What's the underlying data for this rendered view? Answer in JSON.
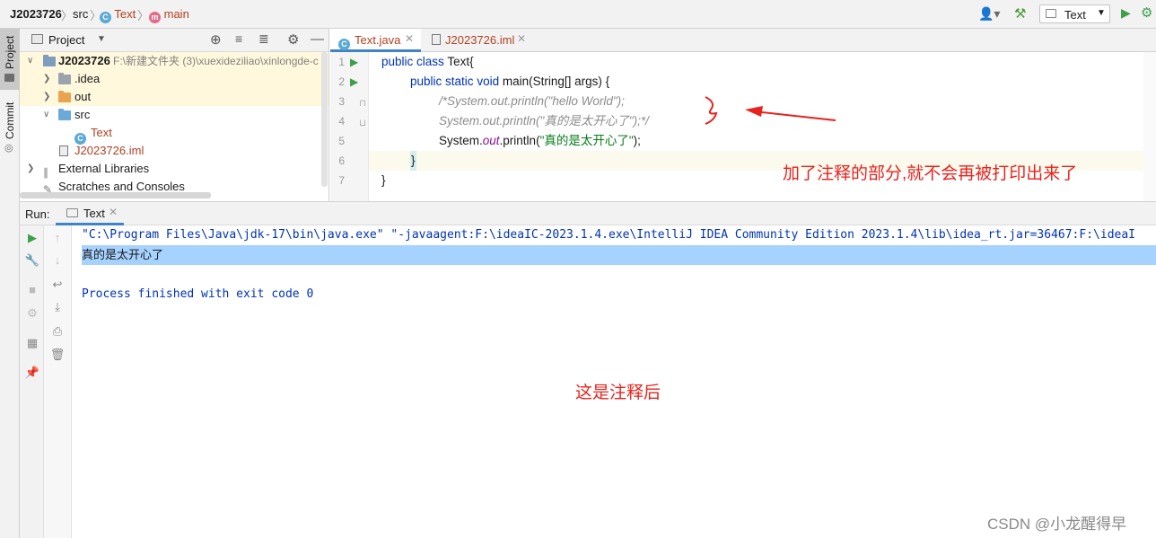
{
  "navbar": {
    "project": "J2023726",
    "src": "src",
    "class": "Text",
    "method": "main",
    "class_icon_letter": "C",
    "method_icon_letter": "m",
    "run_config": "Text"
  },
  "left_strip": {
    "project_tab": "Project",
    "commit_tab": "Commit"
  },
  "project_panel": {
    "title": "Project",
    "tree": [
      {
        "label": "J2023726",
        "path": "F:\\新建文件夹 (3)\\xuexideziliao\\xinlongde-c"
      },
      {
        "label": ".idea"
      },
      {
        "label": "out"
      },
      {
        "label": "src"
      },
      {
        "label": "Text"
      },
      {
        "label": "J2023726.iml"
      },
      {
        "label": "External Libraries"
      },
      {
        "label": "Scratches and Consoles"
      }
    ]
  },
  "editor": {
    "tabs": [
      {
        "label": "Text.java"
      },
      {
        "label": "J2023726.iml"
      }
    ],
    "line_numbers": [
      "1",
      "2",
      "3",
      "4",
      "5",
      "6",
      "7"
    ],
    "code": {
      "l1_kw1": "public",
      "l1_kw2": "class",
      "l1_rest": " Text{",
      "l2_kw1": "public",
      "l2_kw2": "static",
      "l2_kw3": "void",
      "l2_rest": " main(String[] args) {",
      "l3": "/*System.out.println(\"hello World\");",
      "l4": "System.out.println(\"真的是太开心了\");*/",
      "l5_a": "System.",
      "l5_b": "out",
      "l5_c": ".println(",
      "l5_d": "\"真的是太开心了\"",
      "l5_e": ");",
      "l6": "}",
      "l7": "}"
    }
  },
  "annotations": {
    "editor_note": "加了注释的部分,就不会再被打印出来了",
    "console_note": "这是注释后",
    "watermark": "CSDN @小龙醒得早",
    "color": "#e8221c"
  },
  "run": {
    "label": "Run:",
    "tab": "Text",
    "console_lines": [
      "\"C:\\Program Files\\Java\\jdk-17\\bin\\java.exe\" \"-javaagent:F:\\ideaIC-2023.1.4.exe\\IntelliJ IDEA Community Edition 2023.1.4\\lib\\idea_rt.jar=36467:F:\\ideaI",
      "真的是太开心了",
      "",
      "Process finished with exit code 0"
    ]
  },
  "colors": {
    "keyword": "#0033b3",
    "comment": "#8c8c8c",
    "string": "#067d17",
    "selection": "#a6d2ff",
    "run_green": "#3c9f4a"
  }
}
